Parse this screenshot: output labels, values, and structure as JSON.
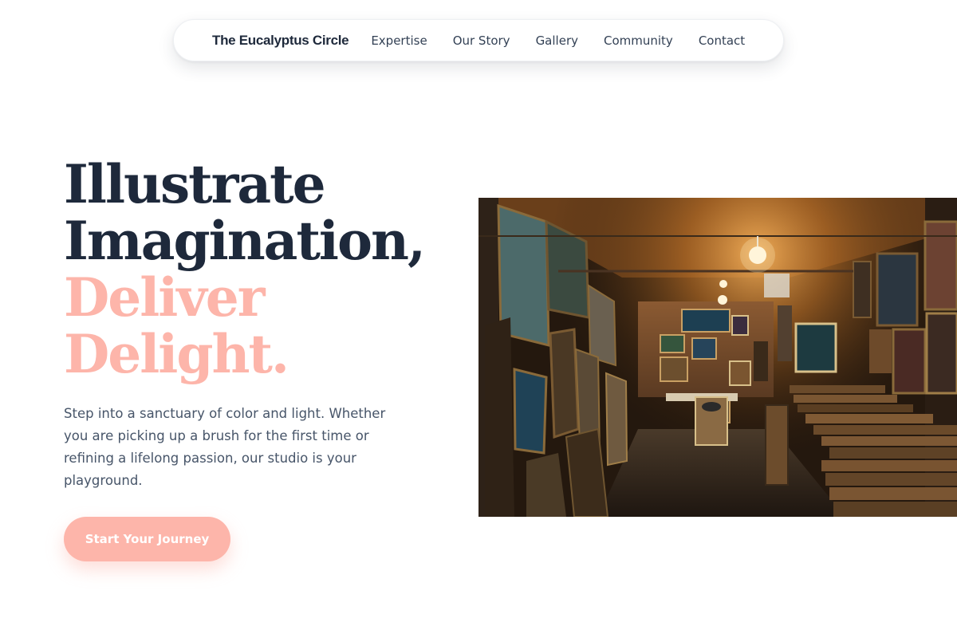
{
  "nav": {
    "brand": "The Eucalyptus Circle",
    "links": [
      "Expertise",
      "Our Story",
      "Gallery",
      "Community",
      "Contact"
    ]
  },
  "hero": {
    "title_lines": [
      "Illustrate",
      "Imagination,"
    ],
    "accent_lines": [
      "Deliver",
      "Delight."
    ],
    "description": "Step into a sanctuary of color and light. Whether you are picking up a brush for the first time or refining a lifelong passion, our studio is your playground.",
    "cta_label": "Start Your Journey"
  },
  "colors": {
    "heading": "#1e293b",
    "accent": "#fdb5aa",
    "body_text": "#475569",
    "nav_text": "#334155"
  }
}
